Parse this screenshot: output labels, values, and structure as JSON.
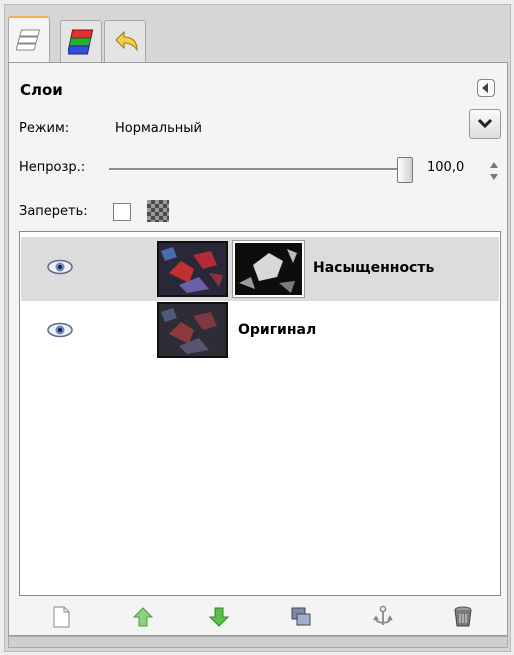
{
  "tabs": [
    {
      "icon": "layers-tab-icon"
    },
    {
      "icon": "channels-tab-icon"
    },
    {
      "icon": "undo-history-tab-icon"
    }
  ],
  "panel": {
    "title": "Слои",
    "mode_label": "Режим:",
    "mode_value": "Нормальный",
    "opacity_label": "Непрозр.:",
    "opacity_value": "100,0",
    "lock_label": "Запереть:"
  },
  "layers": [
    {
      "name": "Насыщенность",
      "visible": true,
      "selected": true,
      "has_mask": true
    },
    {
      "name": "Оригинал",
      "visible": true,
      "selected": false,
      "has_mask": false
    }
  ],
  "toolbar": [
    {
      "icon": "new-layer-icon"
    },
    {
      "icon": "raise-layer-icon"
    },
    {
      "icon": "lower-layer-icon"
    },
    {
      "icon": "duplicate-layer-icon"
    },
    {
      "icon": "anchor-layer-icon"
    },
    {
      "icon": "delete-layer-icon"
    }
  ],
  "colors": {
    "accent_tab": "#f0b24a",
    "selected_row": "#dcdcdc",
    "raise_green": "#7cc46a",
    "lower_green": "#3fa336"
  }
}
